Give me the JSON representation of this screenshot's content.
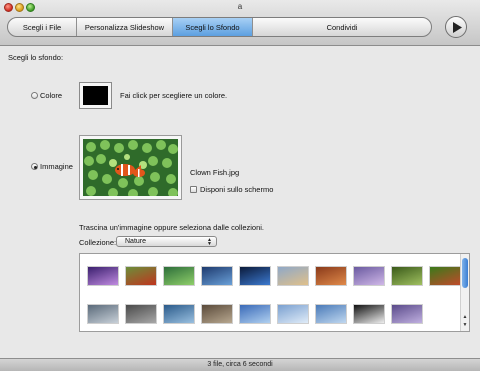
{
  "window": {
    "title": "a"
  },
  "tabs": [
    {
      "label": "Scegli i File",
      "active": false
    },
    {
      "label": "Personalizza Slideshow",
      "active": false
    },
    {
      "label": "Scegli lo Sfondo",
      "active": true
    },
    {
      "label": "Condividi",
      "active": false
    }
  ],
  "background": {
    "section_label": "Scegli lo sfondo:",
    "color_option": {
      "label": "Colore",
      "selected": false,
      "swatch_color": "#000000",
      "hint": "Fai click per scegliere un colore."
    },
    "image_option": {
      "label": "Immagine",
      "selected": true,
      "file_name": "Clown Fish.jpg"
    },
    "arrange_on_screen": {
      "label": "Disponi sullo schermo",
      "checked": false
    },
    "drag_hint": "Trascina un'immagine oppure seleziona dalle collezioni.",
    "collection": {
      "label": "Collezione:",
      "value": "Nature"
    }
  },
  "thumbnails": [
    {
      "name": "aurora",
      "colors": [
        "#3a1f6e",
        "#c08be0"
      ]
    },
    {
      "name": "ladybug",
      "colors": [
        "#6b8f3a",
        "#c0351e"
      ]
    },
    {
      "name": "green-drops",
      "colors": [
        "#2d6e3a",
        "#8fcf6a"
      ]
    },
    {
      "name": "blue-lake",
      "colors": [
        "#1e3a6e",
        "#6aa0d8"
      ]
    },
    {
      "name": "earth",
      "colors": [
        "#0b1a3a",
        "#3c7ad0"
      ]
    },
    {
      "name": "beach",
      "colors": [
        "#8fa8c8",
        "#e0c08a"
      ]
    },
    {
      "name": "canyon",
      "colors": [
        "#8a3a1a",
        "#e08a4a"
      ]
    },
    {
      "name": "purple-waves",
      "colors": [
        "#6a5aa0",
        "#d0b8e8"
      ]
    },
    {
      "name": "grass",
      "colors": [
        "#3a5a1a",
        "#a0c060"
      ]
    },
    {
      "name": "green-leaf",
      "colors": [
        "#3a7a1a",
        "#c04a2a"
      ]
    },
    {
      "name": "cloudy-shore",
      "colors": [
        "#5a6a7a",
        "#c8d0d8"
      ]
    },
    {
      "name": "pebbles",
      "colors": [
        "#4a4a4a",
        "#a8a8a8"
      ]
    },
    {
      "name": "water-ripple",
      "colors": [
        "#2a5a8a",
        "#9ac0e0"
      ]
    },
    {
      "name": "rocks",
      "colors": [
        "#5a4a3a",
        "#b8a890"
      ]
    },
    {
      "name": "blue-drops",
      "colors": [
        "#3a6ab8",
        "#b0d0f0"
      ]
    },
    {
      "name": "light-water",
      "colors": [
        "#7aa0d0",
        "#e0ecf8"
      ]
    },
    {
      "name": "sky-blue",
      "colors": [
        "#4a7ab8",
        "#c0d8f0"
      ]
    },
    {
      "name": "zebra",
      "colors": [
        "#111111",
        "#eeeeee"
      ]
    },
    {
      "name": "purple-sky",
      "colors": [
        "#5a4a8a",
        "#c0b0e0"
      ]
    }
  ],
  "status": {
    "text": "3 file, circa 6 secondi"
  }
}
